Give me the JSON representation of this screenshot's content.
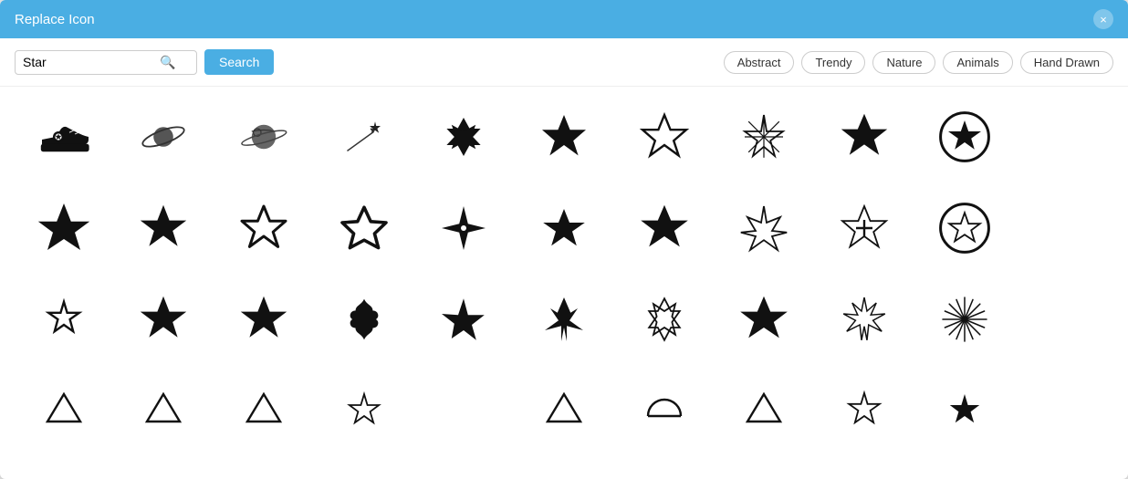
{
  "modal": {
    "title": "Replace Icon",
    "close_label": "×"
  },
  "toolbar": {
    "search_value": "Star",
    "search_placeholder": "Star",
    "search_button_label": "Search",
    "filter_tags": [
      "Abstract",
      "Trendy",
      "Nature",
      "Animals",
      "Hand Drawn"
    ]
  },
  "icons": {
    "rows": 4,
    "columns": 11
  }
}
